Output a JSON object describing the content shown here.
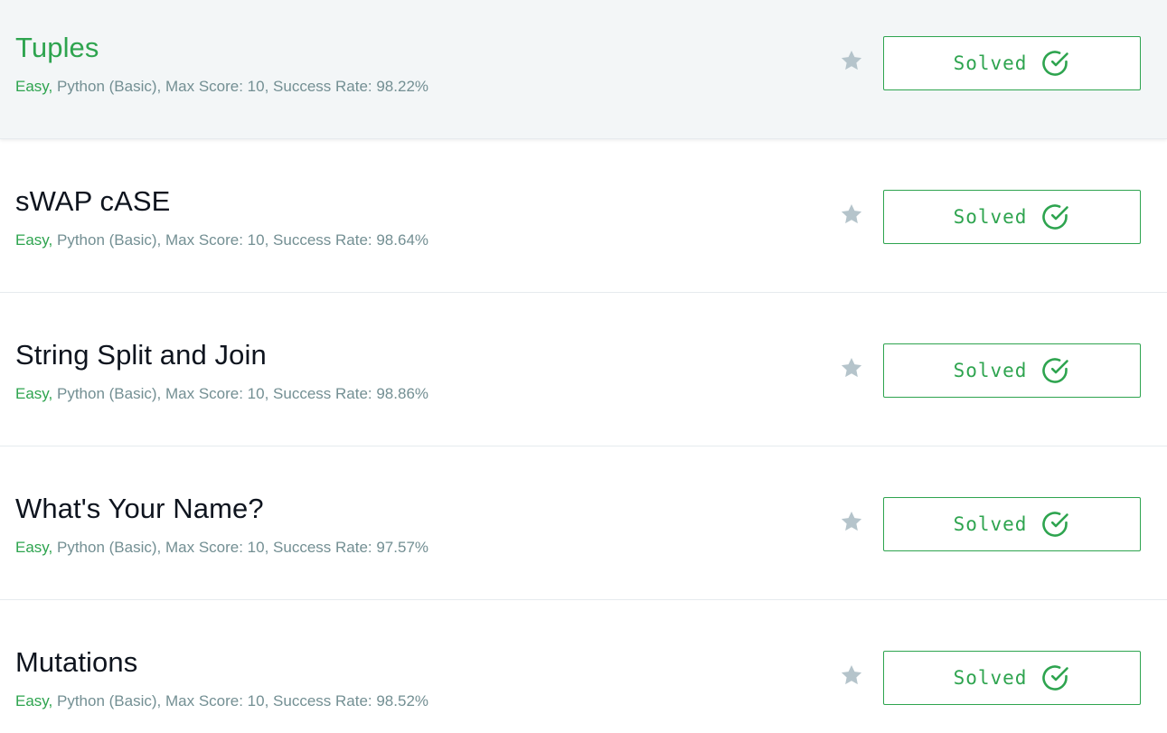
{
  "challenges": [
    {
      "title": "Tuples",
      "difficulty": "Easy,",
      "details": " Python (Basic), Max Score: 10, Success Rate: 98.22%",
      "status_label": "Solved",
      "star_icon": "star-icon",
      "check_icon": "check-circle-icon",
      "hovered": true
    },
    {
      "title": "sWAP cASE",
      "difficulty": "Easy,",
      "details": " Python (Basic), Max Score: 10, Success Rate: 98.64%",
      "status_label": "Solved",
      "star_icon": "star-icon",
      "check_icon": "check-circle-icon",
      "hovered": false
    },
    {
      "title": "String Split and Join",
      "difficulty": "Easy,",
      "details": " Python (Basic), Max Score: 10, Success Rate: 98.86%",
      "status_label": "Solved",
      "star_icon": "star-icon",
      "check_icon": "check-circle-icon",
      "hovered": false
    },
    {
      "title": "What's Your Name?",
      "difficulty": "Easy,",
      "details": " Python (Basic), Max Score: 10, Success Rate: 97.57%",
      "status_label": "Solved",
      "star_icon": "star-icon",
      "check_icon": "check-circle-icon",
      "hovered": false
    },
    {
      "title": "Mutations",
      "difficulty": "Easy,",
      "details": " Python (Basic), Max Score: 10, Success Rate: 98.52%",
      "status_label": "Solved",
      "star_icon": "star-icon",
      "check_icon": "check-circle-icon",
      "hovered": false
    }
  ],
  "colors": {
    "accent_green": "#2ea44f",
    "meta_gray": "#738f93",
    "title_dark": "#0e141e",
    "star_gray": "#b5c4cb",
    "hover_bg": "#f3f6f7"
  }
}
